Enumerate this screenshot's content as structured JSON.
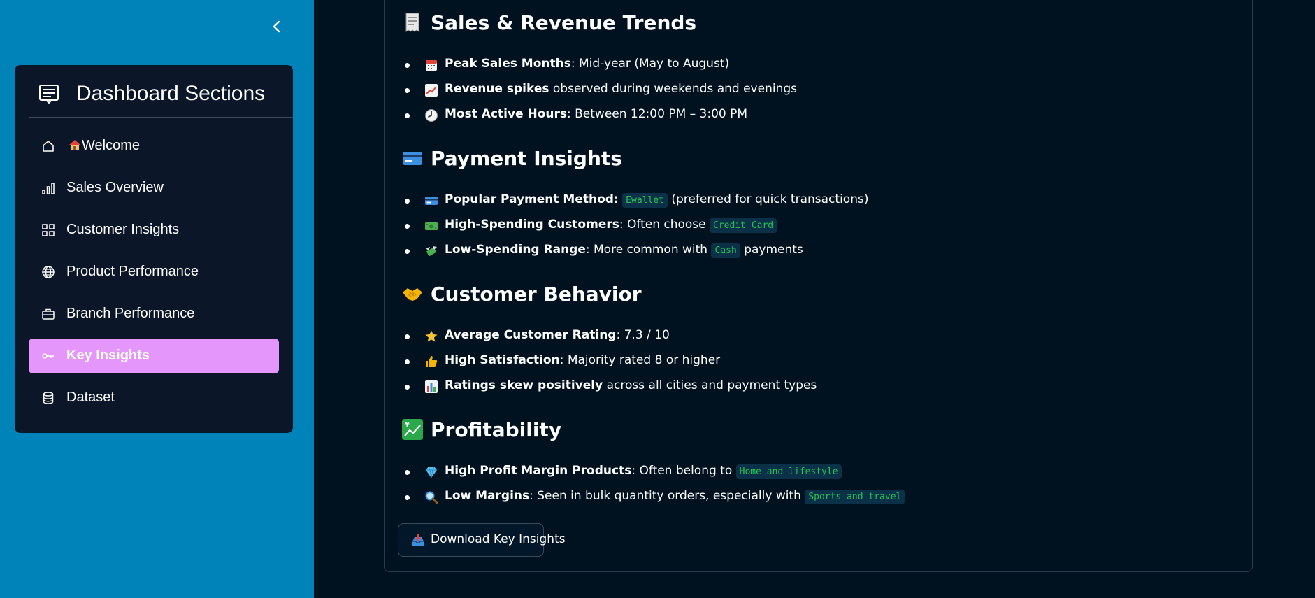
{
  "sidebar": {
    "collapse_icon": "chevron-left-icon",
    "menu": {
      "title": "Dashboard Sections",
      "title_icon": "list-alt-icon",
      "items": [
        {
          "label": "Welcome",
          "icon": "house-icon",
          "emoji": "house-emoji"
        },
        {
          "label": "Sales Overview",
          "icon": "bar-chart-icon"
        },
        {
          "label": "Customer Insights",
          "icon": "grid-icon"
        },
        {
          "label": "Product Performance",
          "icon": "globe-icon"
        },
        {
          "label": "Branch Performance",
          "icon": "briefcase-icon"
        },
        {
          "label": "Key Insights",
          "icon": "key-icon",
          "active": true
        },
        {
          "label": "Dataset",
          "icon": "database-icon"
        }
      ]
    }
  },
  "sections": {
    "sales": {
      "title": "Sales & Revenue Trends",
      "icon": "receipt-emoji",
      "b1": {
        "bold": "Peak Sales Months",
        "rest": ": Mid-year (May to August)"
      },
      "b2": {
        "bold": "Revenue spikes",
        "rest": " observed during weekends and evenings"
      },
      "b3": {
        "bold": "Most Active Hours",
        "rest": ": Between 12:00 PM – 3:00 PM"
      }
    },
    "payment": {
      "title": "Payment Insights",
      "icon": "credit-card-emoji",
      "b1": {
        "bold": "Popular Payment Method:",
        "code": "Ewallet",
        "rest": " (preferred for quick transactions)"
      },
      "b2": {
        "bold": "High-Spending Customers",
        "pre": ": Often choose ",
        "code": "Credit Card"
      },
      "b3": {
        "bold": "Low-Spending Range",
        "pre": ": More common with ",
        "code": "Cash",
        "rest": " payments"
      }
    },
    "behavior": {
      "title": "Customer Behavior",
      "icon": "handshake-emoji",
      "b1": {
        "bold": "Average Customer Rating",
        "rest": ": 7.3 / 10"
      },
      "b2": {
        "bold": "High Satisfaction",
        "rest": ": Majority rated 8 or higher"
      },
      "b3": {
        "bold": "Ratings skew positively",
        "rest": " across all cities and payment types"
      }
    },
    "profit": {
      "title": "Profitability",
      "icon": "chart-yen-emoji",
      "b1": {
        "bold": "High Profit Margin Products",
        "pre": ": Often belong to ",
        "code": "Home and lifestyle"
      },
      "b2": {
        "bold": "Low Margins",
        "pre": ": Seen in bulk quantity orders, especially with ",
        "code": "Sports and travel"
      }
    }
  },
  "download": {
    "label": "Download Key Insights",
    "icon": "inbox-tray-emoji"
  },
  "colors": {
    "sidebar_bg": "#0083b8",
    "menu_bg": "#0b1628",
    "active": "#e596fa",
    "main_bg": "#00111f",
    "code_fg": "#21c354",
    "code_bg": "#0b3148"
  }
}
